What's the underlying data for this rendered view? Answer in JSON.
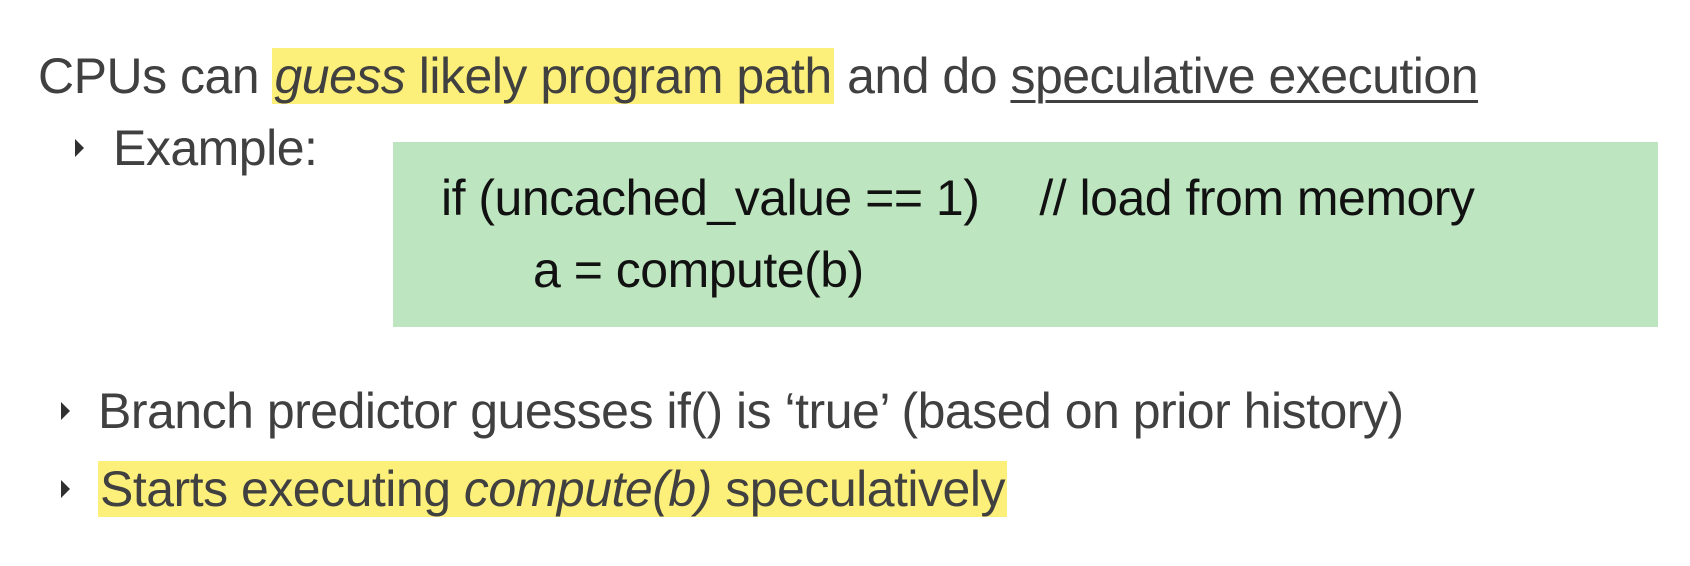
{
  "title": {
    "part1": "CPUs can ",
    "highlight_italic": "guess",
    "highlight_rest": " likely program path",
    "part2": " and do ",
    "underlined": "speculative execution"
  },
  "example_label": "Example:",
  "code": {
    "line1_condition": "if  (uncached_value == 1)",
    "line1_comment": "// load from memory",
    "line2": "a = compute(b)"
  },
  "bullets": [
    {
      "text": "Branch predictor guesses if() is ‘true’  (based on prior history)"
    },
    {
      "part1": "Starts executing ",
      "italic": "compute(b)",
      "part2": " speculatively"
    }
  ],
  "colors": {
    "highlight": "#fdf07a",
    "code_background": "#bde5bf",
    "text": "#404040"
  }
}
